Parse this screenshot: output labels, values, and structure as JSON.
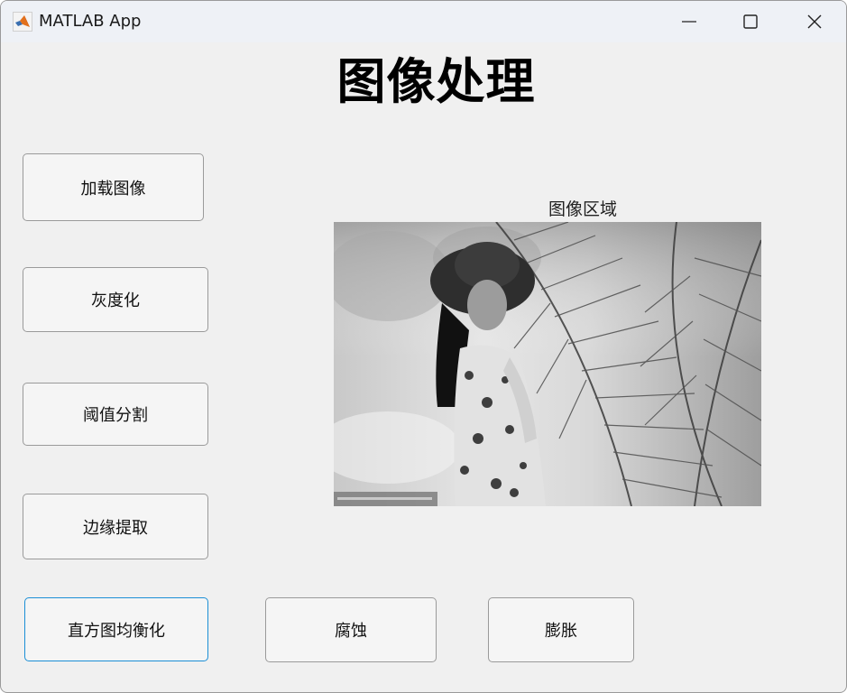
{
  "window": {
    "title": "MATLAB App",
    "controls": {
      "minimize": "minimize-icon",
      "maximize": "maximize-icon",
      "close": "close-icon"
    }
  },
  "heading": "图像处理",
  "buttons": {
    "load": "加载图像",
    "grayscale": "灰度化",
    "threshold": "阈值分割",
    "edge": "边缘提取",
    "histeq": "直方图均衡化",
    "erode": "腐蚀",
    "dilate": "膨胀"
  },
  "axes": {
    "title": "图像区域",
    "image": "grayscale photo of a woman in a bucket hat and floral dress beside palm leaves"
  },
  "colors": {
    "window_bg": "#f0f0f0",
    "titlebar_bg": "#eef1f6",
    "focus_border": "#1b8fd6"
  }
}
